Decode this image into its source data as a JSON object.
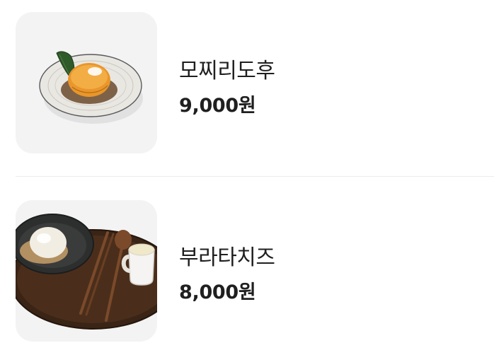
{
  "menu": {
    "items": [
      {
        "name": "모찌리도후",
        "price": "9,000원",
        "image": "mochi-dofu-dish-image"
      },
      {
        "name": "부라타치즈",
        "price": "8,000원",
        "image": "burrata-cheese-dish-image"
      }
    ]
  },
  "colors": {
    "text": "#1f1f1f",
    "thumb_background": "#f3f3f3",
    "divider": "#ececec"
  }
}
